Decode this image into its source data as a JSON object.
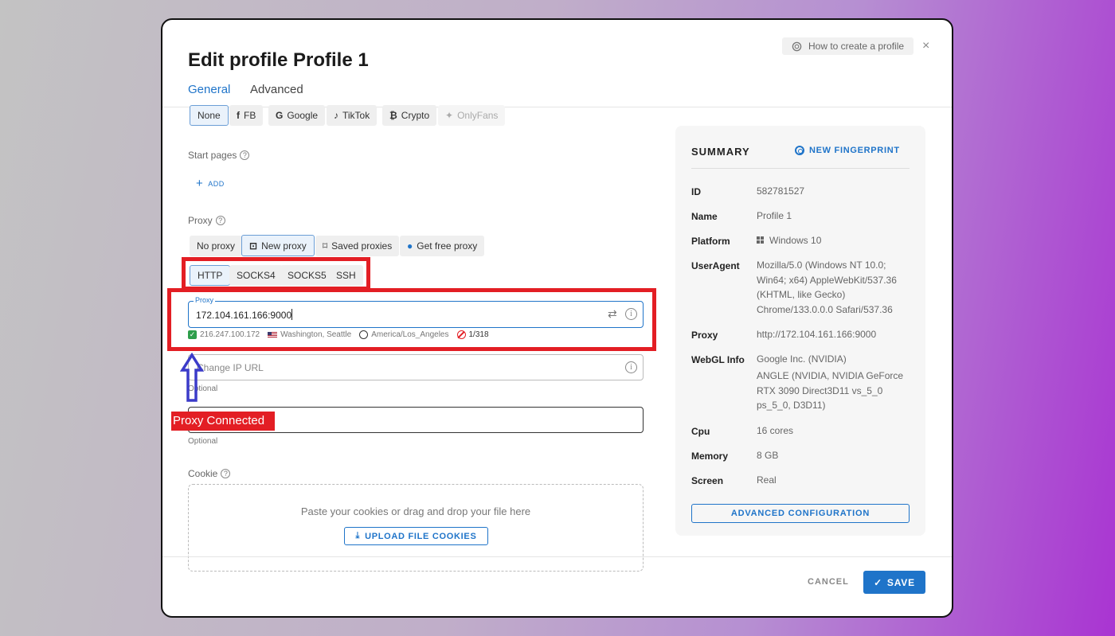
{
  "header": {
    "title": "Edit profile Profile 1",
    "help_button": "How to create a profile",
    "close": "×"
  },
  "tabs": [
    {
      "label": "General",
      "active": true
    },
    {
      "label": "Advanced",
      "active": false
    }
  ],
  "presets": [
    {
      "glyph": "",
      "label": "None",
      "selected": true
    },
    {
      "glyph": "f",
      "label": "FB"
    },
    {
      "glyph": "G",
      "label": "Google"
    },
    {
      "glyph": "♪",
      "label": "TikTok"
    },
    {
      "glyph": "₿",
      "label": "Crypto"
    },
    {
      "glyph": "✦",
      "label": "OnlyFans",
      "disabled": true
    }
  ],
  "start_pages": {
    "label": "Start pages",
    "add_label": "ADD"
  },
  "proxy": {
    "label": "Proxy",
    "modes": [
      "No proxy",
      "New proxy",
      "Saved proxies",
      "Get free proxy"
    ],
    "selected_mode": "New proxy",
    "types": [
      "HTTP",
      "SOCKS4",
      "SOCKS5",
      "SSH"
    ],
    "selected_type": "HTTP",
    "field_legend": "Proxy",
    "value": "172.104.161.166:9000",
    "status": {
      "ip": "216.247.100.172",
      "location": "Washington, Seattle",
      "timezone": "America/Los_Angeles",
      "count": "1/318"
    },
    "change_ip_placeholder": "Change IP URL",
    "optional_1": "Optional",
    "optional_2": "Optional"
  },
  "annotation": {
    "label": "Proxy Connected",
    "color": "#e31e24",
    "arrow_color": "#3b3bc9"
  },
  "cookie": {
    "label": "Cookie",
    "dropzone_text": "Paste your cookies or drag and drop your file here",
    "upload_label": "UPLOAD FILE COOKIES"
  },
  "summary": {
    "title": "SUMMARY",
    "new_fingerprint": "NEW FINGERPRINT",
    "rows": [
      {
        "label": "ID",
        "value": "582781527"
      },
      {
        "label": "Name",
        "value": "Profile 1"
      },
      {
        "label": "Platform",
        "value": "Windows 10"
      },
      {
        "label": "UserAgent",
        "value": "Mozilla/5.0 (Windows NT 10.0; Win64; x64) AppleWebKit/537.36 (KHTML, like Gecko) Chrome/133.0.0.0 Safari/537.36"
      },
      {
        "label": "Proxy",
        "value": "http://172.104.161.166:9000"
      },
      {
        "label": "WebGL Info",
        "value": "Google Inc. (NVIDIA)",
        "value2": "ANGLE (NVIDIA, NVIDIA GeForce RTX 3090 Direct3D11 vs_5_0 ps_5_0, D3D11)"
      },
      {
        "label": "Cpu",
        "value": "16 cores"
      },
      {
        "label": "Memory",
        "value": "8 GB"
      },
      {
        "label": "Screen",
        "value": "Real"
      }
    ],
    "advanced_button": "ADVANCED CONFIGURATION"
  },
  "footer": {
    "cancel": "CANCEL",
    "save": "SAVE"
  },
  "colors": {
    "accent": "#1f74c9",
    "highlight": "#e31e24"
  }
}
